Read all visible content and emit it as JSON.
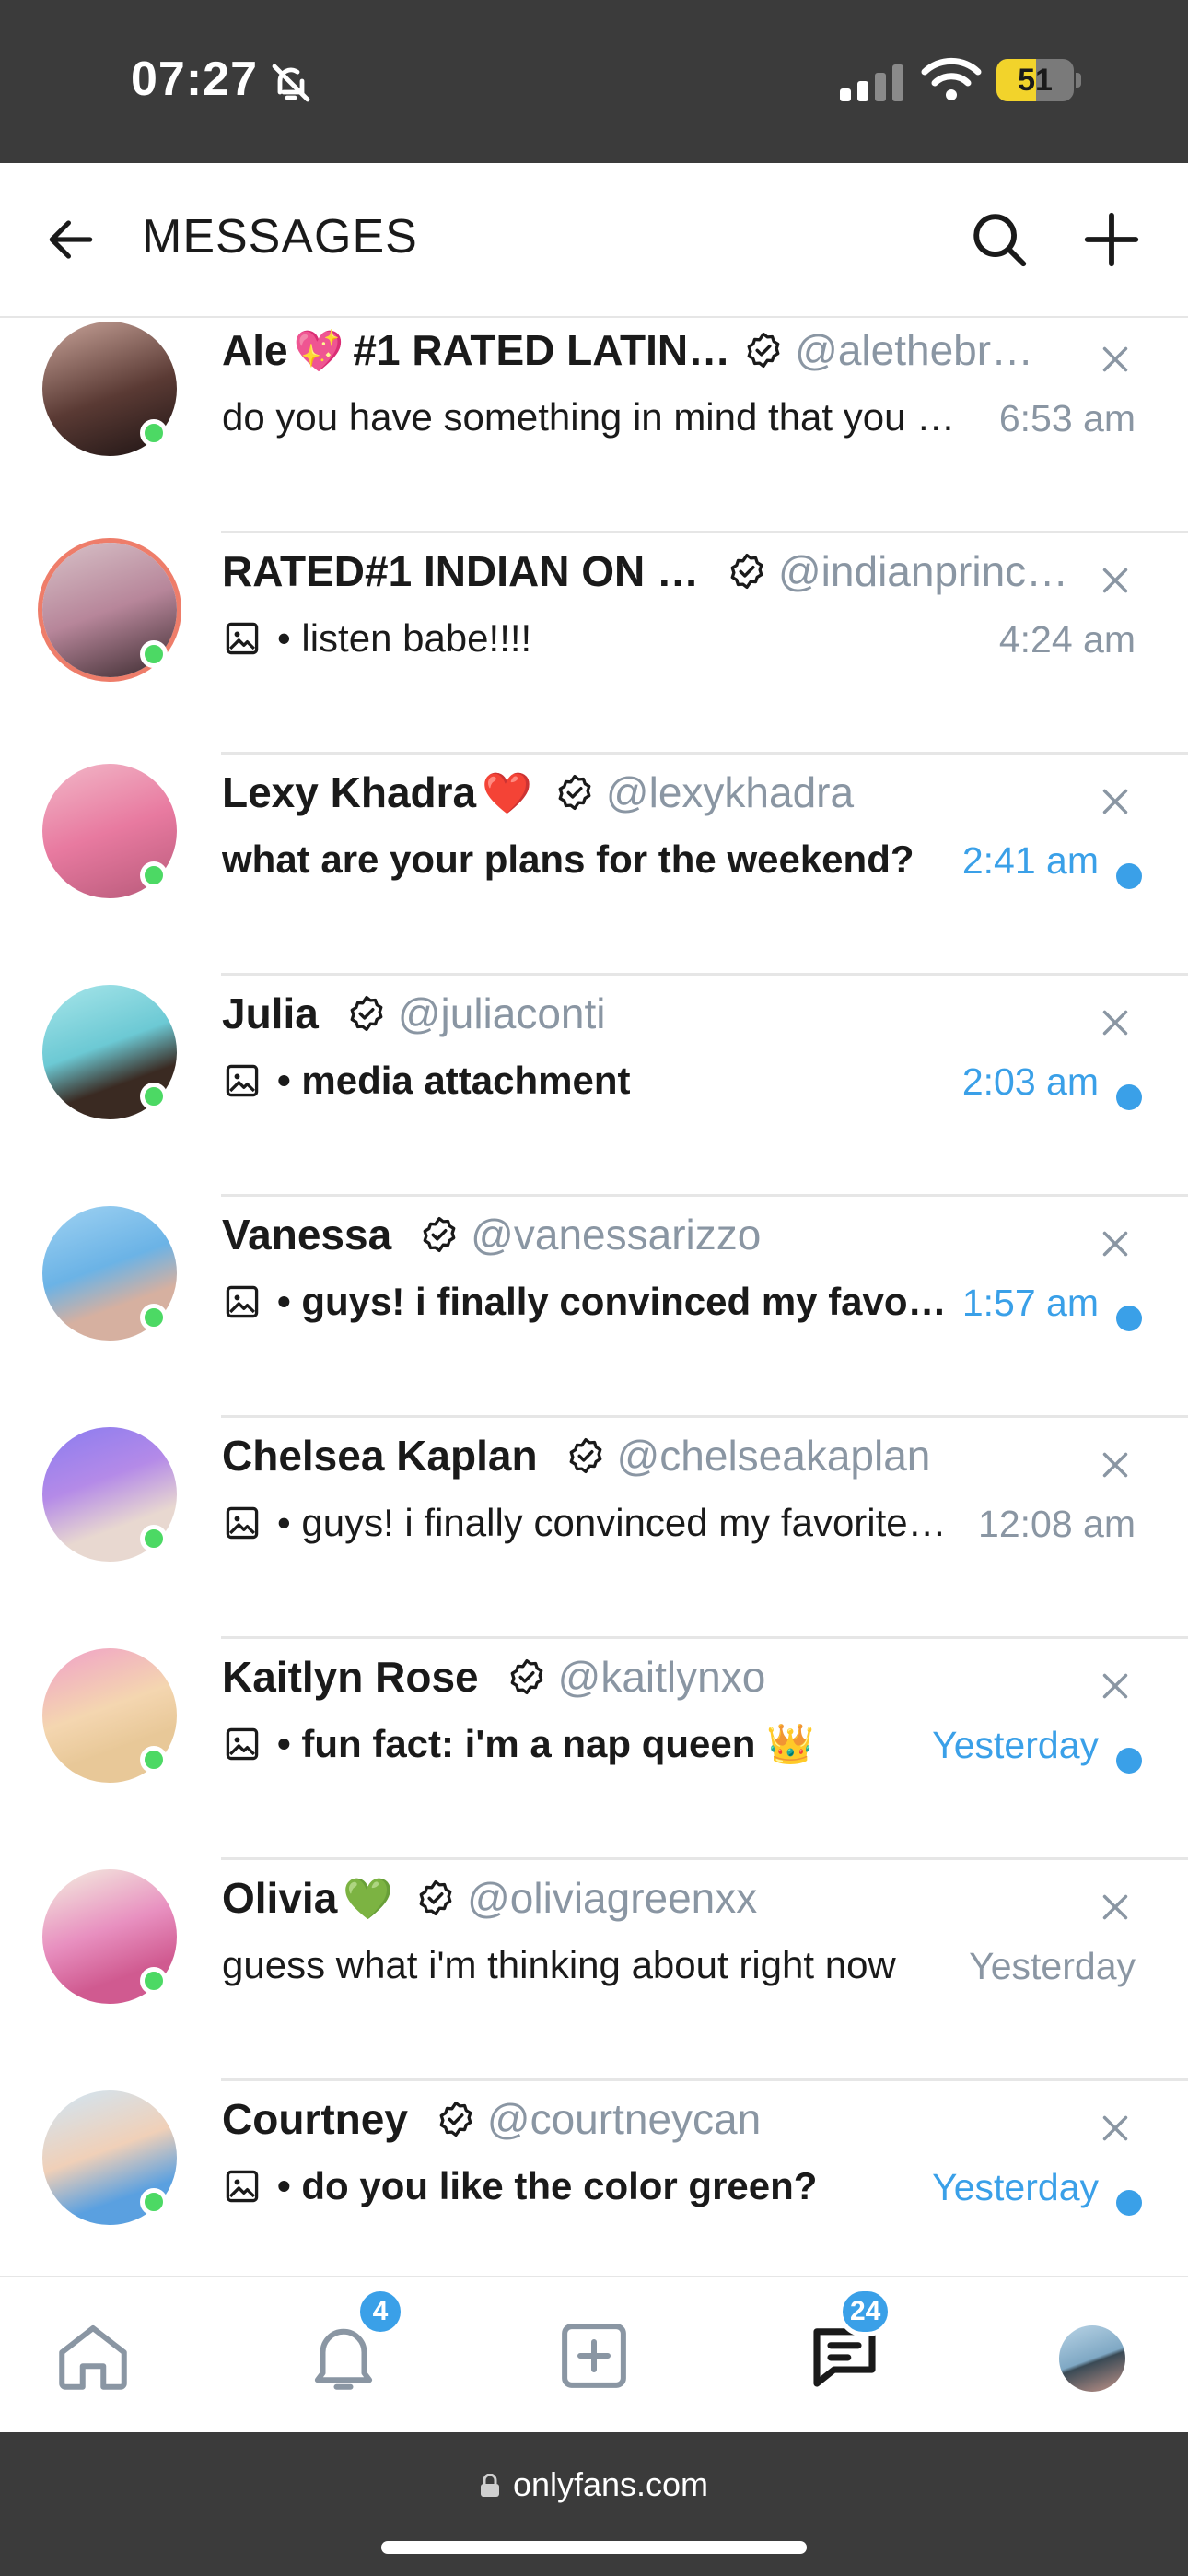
{
  "status_bar": {
    "time": "07:27",
    "battery_level": "51",
    "battery_fraction": 0.51
  },
  "header": {
    "title": "MESSAGES"
  },
  "colors": {
    "accent": "#3aa0e8",
    "online": "#4cd964",
    "muted": "#8a96a3"
  },
  "conversations": [
    {
      "name": "Ale",
      "emoji": "💖",
      "name_suffix": "#1 RATED LATIN…",
      "handle": "@alethebr…",
      "preview": "do you have something in mind that you …",
      "time": "6:53 am",
      "unread": false,
      "has_media": false,
      "bold": false
    },
    {
      "name": "RATED#1 INDIAN ON …",
      "emoji": "",
      "name_suffix": "",
      "handle": "@indianprinc…",
      "preview": "• listen babe!!!!",
      "time": "4:24 am",
      "unread": false,
      "has_media": true,
      "bold": false
    },
    {
      "name": "Lexy Khadra",
      "emoji": "❤️",
      "name_suffix": "",
      "handle": "@lexykhadra",
      "preview": "what are your plans for the weekend?",
      "time": "2:41 am",
      "unread": true,
      "has_media": false,
      "bold": true
    },
    {
      "name": "Julia",
      "emoji": "",
      "name_suffix": "",
      "handle": "@juliaconti",
      "preview": "• media attachment",
      "time": "2:03 am",
      "unread": true,
      "has_media": true,
      "bold": true
    },
    {
      "name": "Vanessa",
      "emoji": "",
      "name_suffix": "",
      "handle": "@vanessarizzo",
      "preview": "• guys! i finally convinced my favori…",
      "time": "1:57 am",
      "unread": true,
      "has_media": true,
      "bold": true
    },
    {
      "name": "Chelsea Kaplan",
      "emoji": "",
      "name_suffix": "",
      "handle": "@chelseakaplan",
      "preview": "• guys! i finally convinced my favorite…",
      "time": "12:08 am",
      "unread": false,
      "has_media": true,
      "bold": false
    },
    {
      "name": "Kaitlyn Rose",
      "emoji": "",
      "name_suffix": "",
      "handle": "@kaitlynxo",
      "preview": "• fun fact: i'm a nap queen 👑",
      "time": "Yesterday",
      "unread": true,
      "has_media": true,
      "bold": true
    },
    {
      "name": "Olivia",
      "emoji": "💚",
      "name_suffix": "",
      "handle": "@oliviagreenxx",
      "preview": "guess what i'm thinking about right now",
      "time": "Yesterday",
      "unread": false,
      "has_media": false,
      "bold": false
    },
    {
      "name": "Courtney",
      "emoji": "",
      "name_suffix": "",
      "handle": "@courtneycan",
      "preview": "• do you like the color green?",
      "time": "Yesterday",
      "unread": true,
      "has_media": true,
      "bold": true
    }
  ],
  "bottom_nav": {
    "notifications_badge": "4",
    "messages_badge": "24"
  },
  "browser": {
    "url": "onlyfans.com"
  }
}
